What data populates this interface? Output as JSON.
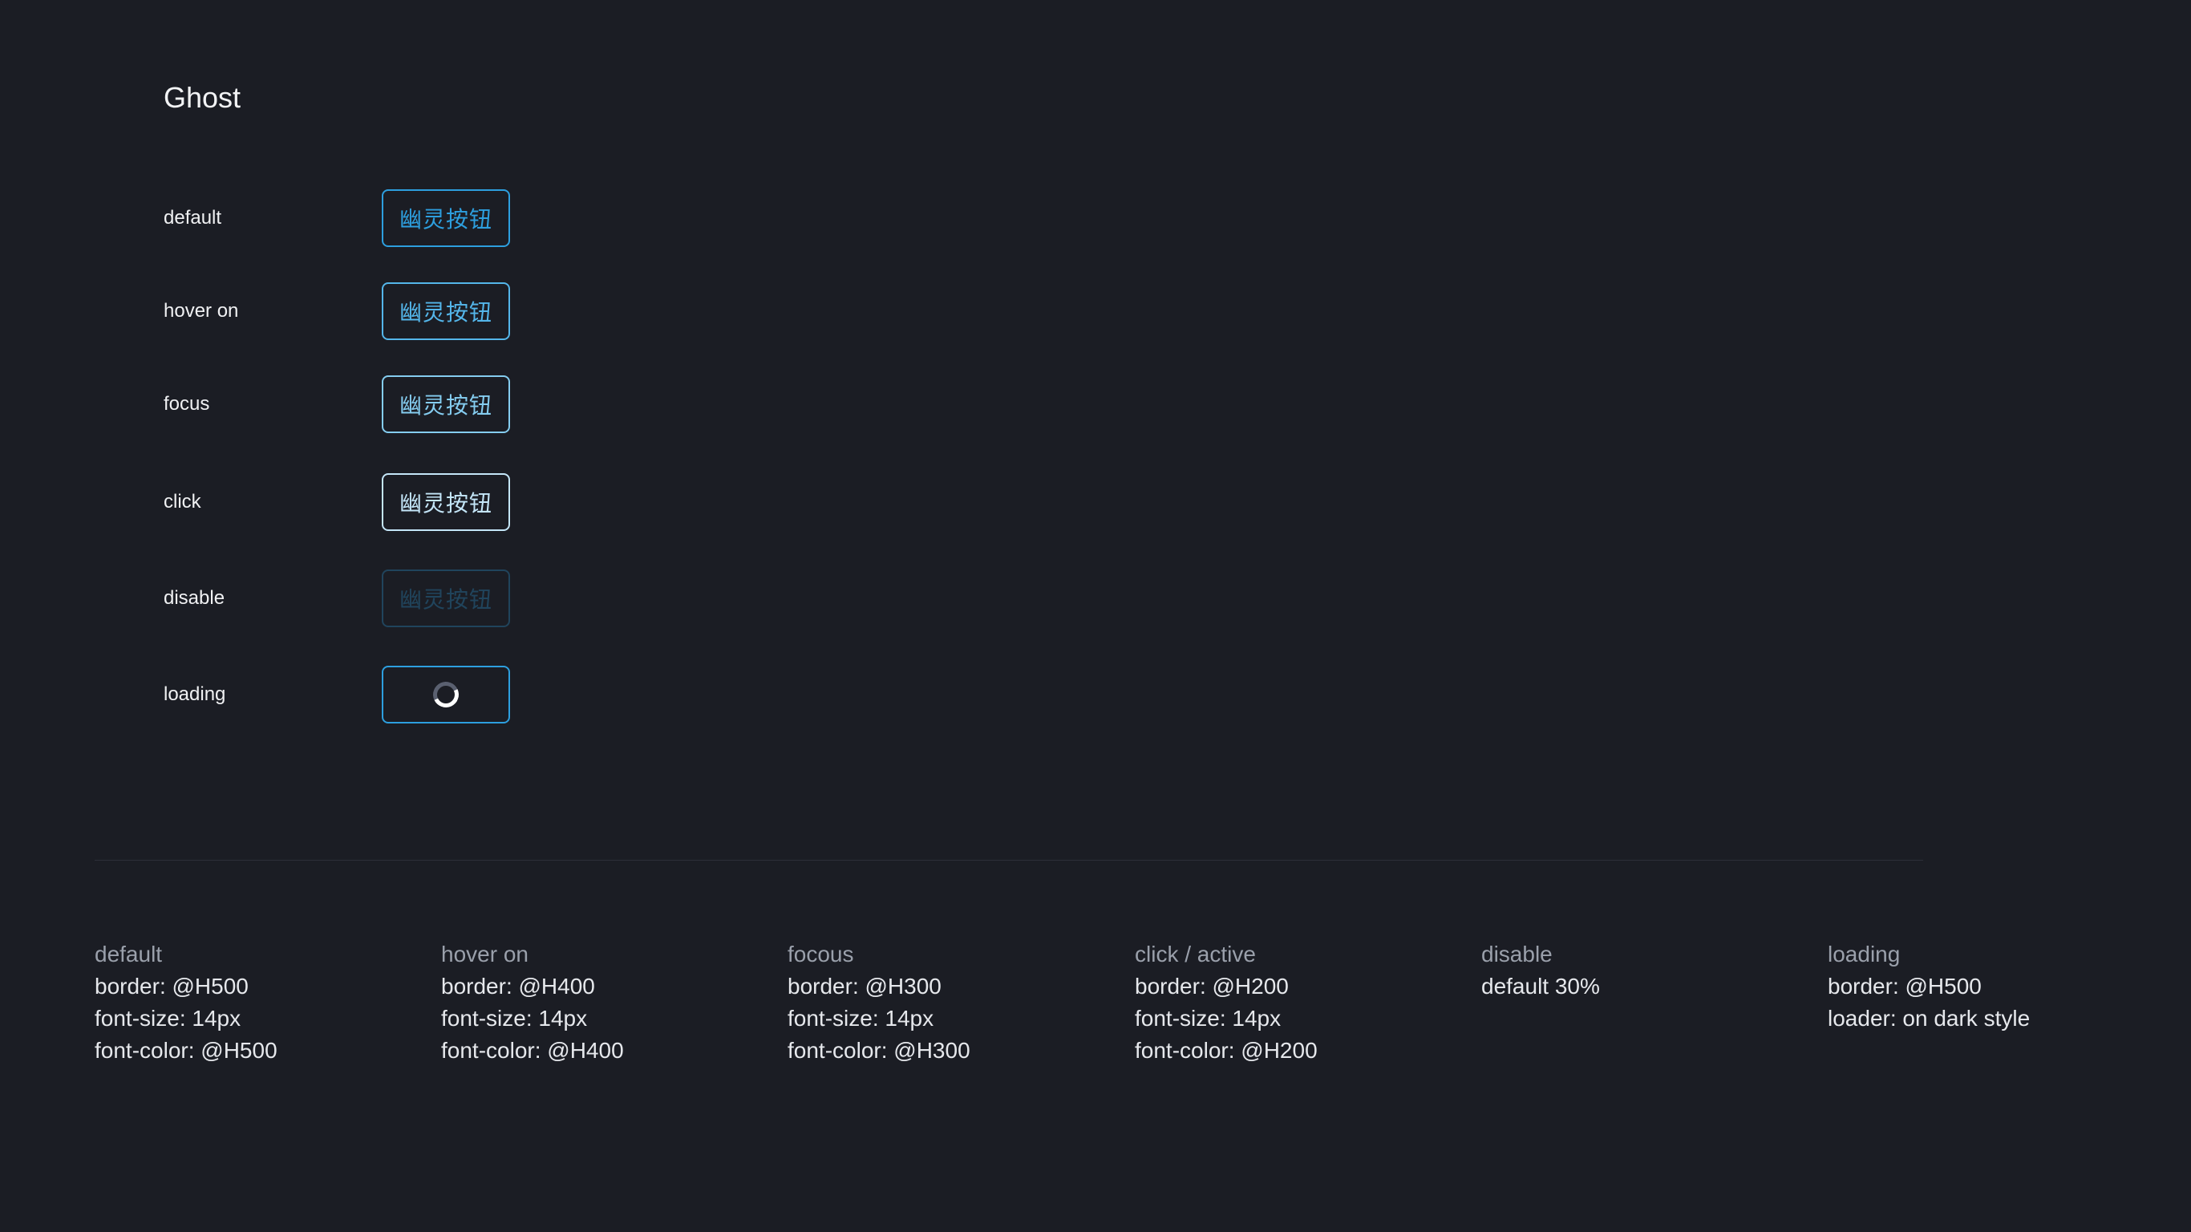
{
  "section": {
    "title": "Ghost"
  },
  "rows": [
    {
      "label": "default",
      "button": "幽灵按钮"
    },
    {
      "label": "hover on",
      "button": "幽灵按钮"
    },
    {
      "label": "focus",
      "button": "幽灵按钮"
    },
    {
      "label": "click",
      "button": "幽灵按钮"
    },
    {
      "label": "disable",
      "button": "幽灵按钮"
    },
    {
      "label": "loading",
      "button": ""
    }
  ],
  "specs": [
    {
      "title": "default",
      "lines": [
        "border: @H500",
        "font-size: 14px",
        "font-color: @H500"
      ]
    },
    {
      "title": "hover on",
      "lines": [
        "border: @H400",
        "font-size: 14px",
        "font-color: @H400"
      ]
    },
    {
      "title": "focous",
      "lines": [
        "border: @H300",
        "font-size: 14px",
        "font-color: @H300"
      ]
    },
    {
      "title": "click / active",
      "lines": [
        "border: @H200",
        "font-size: 14px",
        "font-color: @H200"
      ]
    },
    {
      "title": "disable",
      "lines": [
        "default 30%"
      ]
    },
    {
      "title": "loading",
      "lines": [
        "border: @H500",
        "loader: on dark style"
      ]
    }
  ],
  "colors": {
    "background": "#1b1d24",
    "H500": "#2d9fdf",
    "H400": "#54b6ea",
    "H300": "#85cdf0",
    "H200": "#c4e6f8"
  },
  "icons": {
    "loading": "spinner-icon"
  }
}
